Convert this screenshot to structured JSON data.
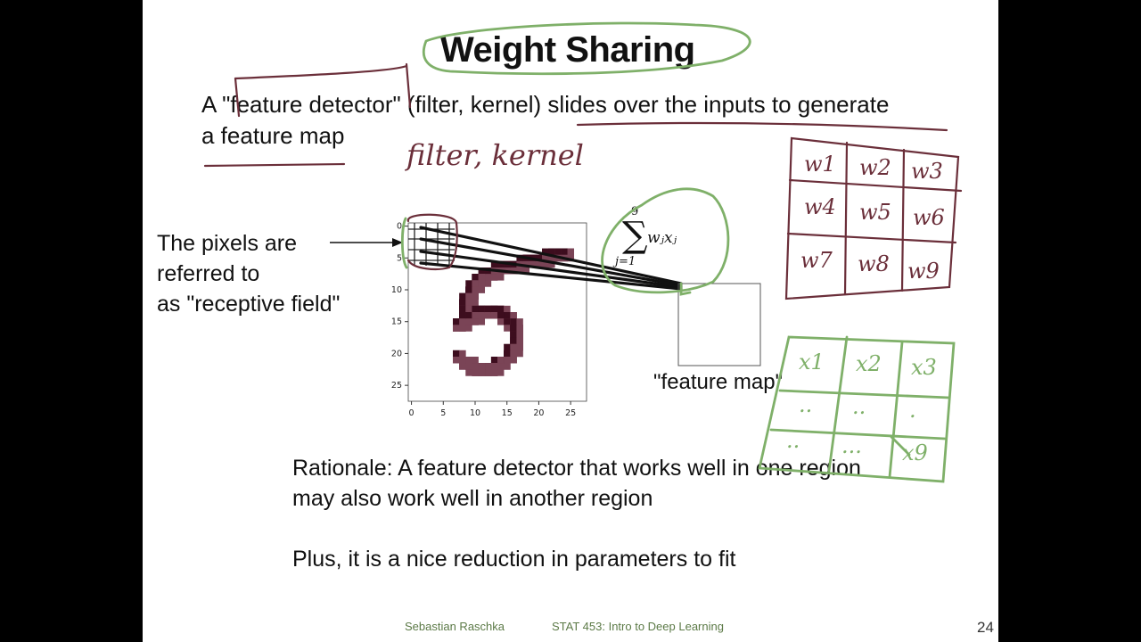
{
  "title": "Weight Sharing",
  "intro": {
    "line1": "A \"feature detector\" (filter, kernel) slides over the inputs to generate",
    "line2": "a feature map"
  },
  "receptive_field": {
    "line1": "The pixels are",
    "line2": "referred to",
    "line3": "as \"receptive field\""
  },
  "feature_map_label": "\"feature map\"",
  "formula": {
    "upper": "9",
    "lower": "j=1",
    "term": "wⱼxⱼ"
  },
  "mnist_axes": {
    "x_ticks": [
      "0",
      "5",
      "10",
      "15",
      "20",
      "25"
    ],
    "y_ticks": [
      "0",
      "5",
      "10",
      "15",
      "20",
      "25"
    ]
  },
  "rationale": {
    "line1": "Rationale: A feature detector that works well in one region",
    "line2": "may also work well in another region"
  },
  "plus": "Plus, it is a nice reduction in parameters to fit",
  "annotations": {
    "handwritten": "filter, kernel",
    "weights": [
      "w1",
      "w2",
      "w3",
      "w4",
      "w5",
      "w6",
      "w7",
      "w8",
      "w9"
    ],
    "inputs": [
      "x1",
      "x2",
      "x3",
      "..",
      "..",
      ".",
      "..",
      "...",
      "x9"
    ]
  },
  "footer": {
    "author": "Sebastian Raschka",
    "course": "STAT 453: Intro to Deep Learning",
    "page": "24"
  },
  "colors": {
    "ink_dark": "#6b2f3a",
    "ink_green": "#7fb069",
    "digit": "#3d0d1e",
    "footer": "#5c7a47"
  }
}
